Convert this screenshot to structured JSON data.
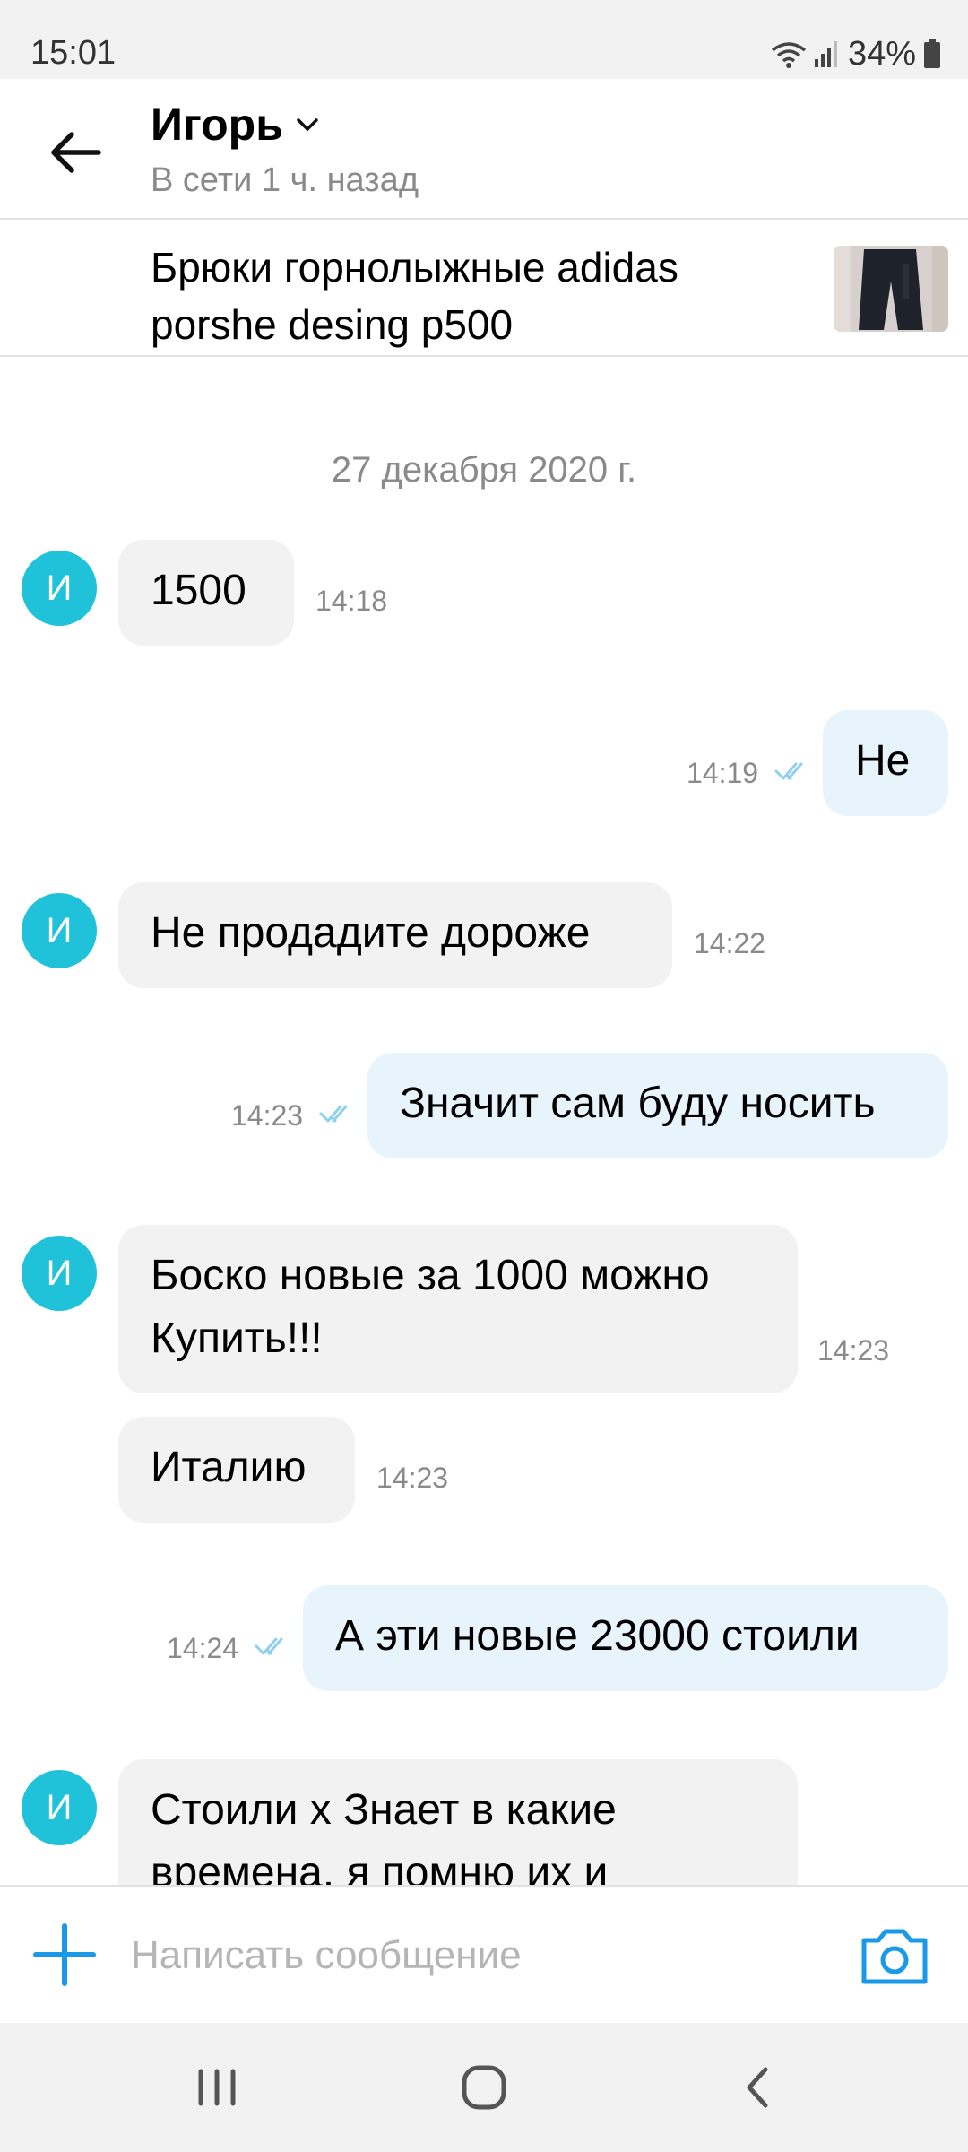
{
  "status_bar": {
    "time": "15:01",
    "battery": "34%"
  },
  "header": {
    "contact_name": "Игорь",
    "presence": "В сети 1 ч. назад"
  },
  "item": {
    "title": "Брюки горнолыжные adidas porshe desing p500"
  },
  "chat": {
    "date": "27 декабря 2020 г.",
    "avatar_letter": "И",
    "messages": [
      {
        "dir": "in",
        "text": "1500",
        "time": "14:18"
      },
      {
        "dir": "out",
        "text": "Не",
        "time": "14:19"
      },
      {
        "dir": "in",
        "text": "Не продадите дороже",
        "time": "14:22"
      },
      {
        "dir": "out",
        "text": "Значит сам буду носить",
        "time": "14:23"
      },
      {
        "dir": "in",
        "text": "Боско новые за 1000 можно Купить!!!",
        "time": "14:23"
      },
      {
        "dir": "in",
        "text": "Италию",
        "time": "14:23"
      },
      {
        "dir": "out",
        "text": "А эти новые 23000 стоили",
        "time": "14:24"
      },
      {
        "dir": "in",
        "text": "Стоили х Знает в какие времена, я помню их и",
        "time": ""
      }
    ]
  },
  "composer": {
    "placeholder": "Написать сообщение"
  },
  "colors": {
    "accent": "#1a9ae6",
    "avatar": "#1fc2d8",
    "out_bubble": "#e8f4fc",
    "in_bubble": "#f2f2f2",
    "read_check": "#8fd0f0"
  },
  "icons": [
    "back-arrow-icon",
    "chevron-down-icon",
    "plus-icon",
    "camera-icon",
    "read-check-icon",
    "wifi-icon",
    "signal-icon",
    "battery-icon",
    "recent-apps-icon",
    "home-icon",
    "nav-back-icon"
  ]
}
